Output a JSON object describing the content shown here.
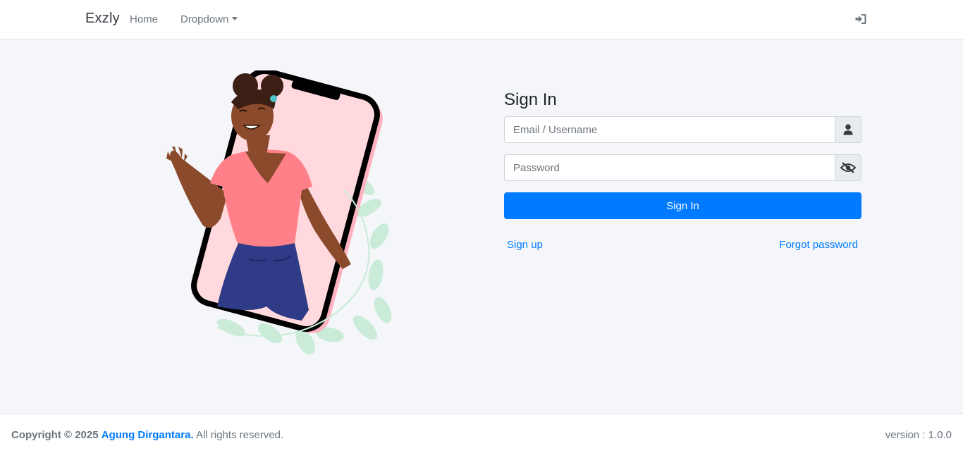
{
  "navbar": {
    "brand": "Exzly",
    "home_label": "Home",
    "dropdown_label": "Dropdown",
    "login_icon": "sign-in-icon"
  },
  "illustration": {
    "description_icon": "woman-phone-illustration",
    "colors": {
      "phone_screen": "#ffd9dd",
      "shirt": "#ff8088",
      "jeans": "#2f3b87",
      "skin": "#8b4a2b",
      "leaves": "#c9ebd8"
    }
  },
  "form": {
    "title": "Sign In",
    "email_placeholder": "Email / Username",
    "email_icon": "user-icon",
    "password_placeholder": "Password",
    "password_icon": "eye-slash-icon",
    "submit_label": "Sign In",
    "signup_label": "Sign up",
    "forgot_label": "Forgot password"
  },
  "footer": {
    "copyright_prefix": "Copyright © 2025",
    "author": "Agung Dirgantara.",
    "rights": "All rights reserved.",
    "version": "version : 1.0.0"
  },
  "colors": {
    "primary": "#007bff",
    "background": "#f4f6f9",
    "muted": "#6c757d"
  }
}
